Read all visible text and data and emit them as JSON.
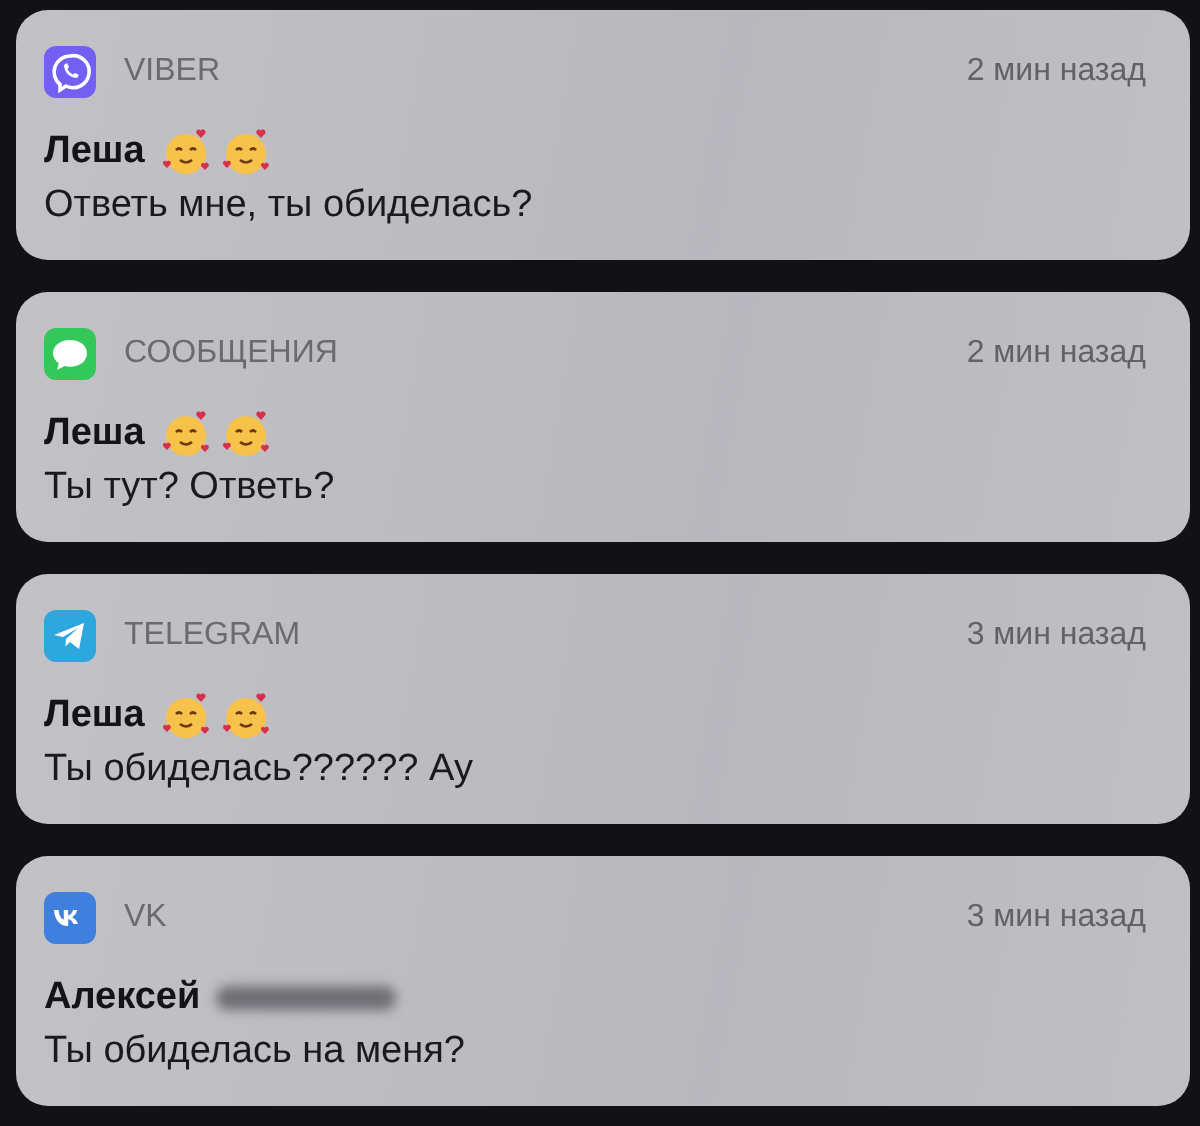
{
  "notifications": [
    {
      "kind": "viber",
      "app": "VIBER",
      "time": "2 мин назад",
      "sender": "Леша",
      "sender_redacted": false,
      "message": "Ответь мне, ты обиделась?"
    },
    {
      "kind": "messages",
      "app": "СООБЩЕНИЯ",
      "time": "2 мин назад",
      "sender": "Леша",
      "sender_redacted": false,
      "message": "Ты тут? Ответь?"
    },
    {
      "kind": "telegram",
      "app": "TELEGRAM",
      "time": "3 мин назад",
      "sender": "Леша",
      "sender_redacted": false,
      "message": "Ты обиделась?????? Ау"
    },
    {
      "kind": "vk",
      "app": "VK",
      "time": "3 мин назад",
      "sender": "Алексей",
      "sender_redacted": true,
      "message": "Ты обиделась на меня?"
    }
  ]
}
